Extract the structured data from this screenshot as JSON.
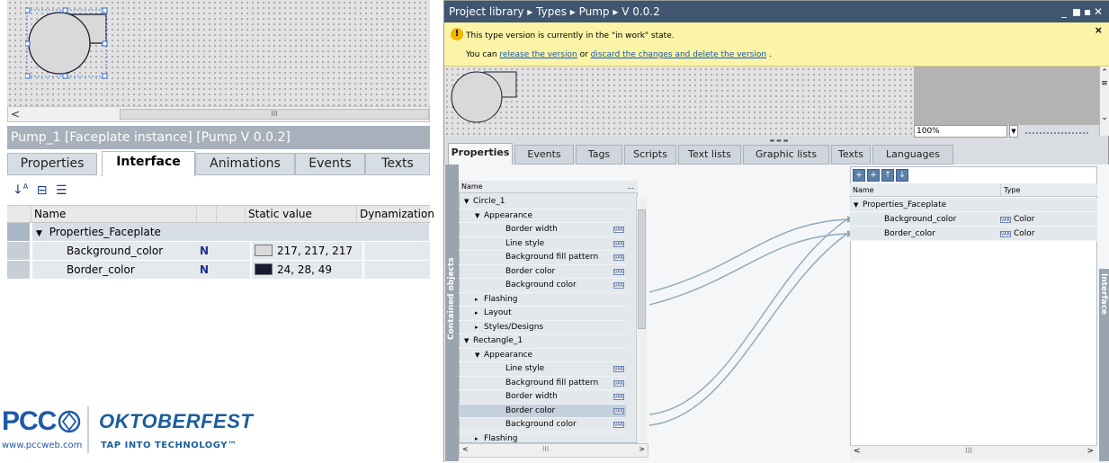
{
  "left": {
    "title": "Pump_1 [Faceplate instance] [Pump V 0.0.2]",
    "tabs": [
      "Properties",
      "Interface",
      "Animations",
      "Events",
      "Texts"
    ],
    "active_tab": "Interface",
    "hscroll_left": "<",
    "hscroll_grip": "III",
    "toolbar_icons": [
      "sort-icon",
      "group-icon",
      "list-icon"
    ],
    "columns": {
      "name": "Name",
      "static": "Static value",
      "dynamization": "Dynamization"
    },
    "rows": [
      {
        "label": "Properties_Faceplate",
        "expander": "▼"
      },
      {
        "label": "Background_color",
        "value": "217, 217, 217",
        "swatch": "#d9d9d9",
        "link_icon": "N"
      },
      {
        "label": "Border_color",
        "value": "24, 28, 49",
        "swatch": "#181c31",
        "link_icon": "N"
      }
    ]
  },
  "logo": {
    "brand": "PCC",
    "website": "www.pccweb.com",
    "event": "OKTOBERFEST",
    "tagline": "TAP INTO TECHNOLOGY™"
  },
  "right": {
    "breadcrumb": "Project library  ▸  Types  ▸  Pump  ▸  V 0.0.2",
    "window_controls": "_ ◼ ▪ ✕",
    "info": {
      "line1": "This type version is currently in the \"in work\" state.",
      "line2_prefix": "You can",
      "link1": "release the version",
      "line2_mid": "or",
      "link2": "discard the changes and delete the version",
      "line2_suffix": ".",
      "close": "×"
    },
    "zoom": "100%",
    "tabs": [
      "Properties",
      "Events",
      "Tags",
      "Scripts",
      "Text lists",
      "Graphic lists",
      "Texts",
      "Languages"
    ],
    "active_tab": "Properties",
    "contained_label": "Contained objects",
    "interface_label": "Interface",
    "tree_header": "Name",
    "tree_header_btn": "...",
    "tree": [
      {
        "text": "Circle_1",
        "indent": 0,
        "exp": "▼",
        "badge": false
      },
      {
        "text": "Appearance",
        "indent": 1,
        "exp": "▼",
        "badge": false
      },
      {
        "text": "Border width",
        "indent": 3,
        "exp": "",
        "badge": true
      },
      {
        "text": "Line style",
        "indent": 3,
        "exp": "",
        "badge": true
      },
      {
        "text": "Background fill pattern",
        "indent": 3,
        "exp": "",
        "badge": true
      },
      {
        "text": "Border color",
        "indent": 3,
        "exp": "",
        "badge": true
      },
      {
        "text": "Background color",
        "indent": 3,
        "exp": "",
        "badge": true
      },
      {
        "text": "Flashing",
        "indent": 1,
        "exp": "▸",
        "badge": false
      },
      {
        "text": "Layout",
        "indent": 1,
        "exp": "▸",
        "badge": false
      },
      {
        "text": "Styles/Designs",
        "indent": 1,
        "exp": "▸",
        "badge": false
      },
      {
        "text": "Rectangle_1",
        "indent": 0,
        "exp": "▼",
        "badge": false
      },
      {
        "text": "Appearance",
        "indent": 1,
        "exp": "▼",
        "badge": false
      },
      {
        "text": "Line style",
        "indent": 3,
        "exp": "",
        "badge": true
      },
      {
        "text": "Background fill pattern",
        "indent": 3,
        "exp": "",
        "badge": true
      },
      {
        "text": "Border width",
        "indent": 3,
        "exp": "",
        "badge": true
      },
      {
        "text": "Border color",
        "indent": 3,
        "exp": "",
        "badge": true,
        "selected": true
      },
      {
        "text": "Background color",
        "indent": 3,
        "exp": "",
        "badge": true
      },
      {
        "text": "Flashing",
        "indent": 1,
        "exp": "▸",
        "badge": false
      }
    ],
    "badge_text": "VAR",
    "interface_columns": {
      "name": "Name",
      "type": "Type"
    },
    "interface_rows": [
      {
        "label": "Properties_Faceplate",
        "indent": 0,
        "exp": "▼",
        "type": ""
      },
      {
        "label": "Background_color",
        "indent": 2,
        "exp": "",
        "type": "Color"
      },
      {
        "label": "Border_color",
        "indent": 2,
        "exp": "",
        "type": "Color"
      }
    ],
    "interface_toolbar_icons": [
      "add-property-icon",
      "add-event-icon",
      "move-up-icon",
      "move-down-icon"
    ],
    "scroll_left": "<",
    "scroll_right": ">",
    "scroll_grip": "III"
  },
  "colors": {
    "title_bar": "#3f5570",
    "info_bar": "#fbf3a6",
    "link_line": "#8fa8b8",
    "left_title": "#a7b0bb",
    "pcc_blue": "#1f5aa8",
    "okt_blue": "#1c5e9e"
  }
}
